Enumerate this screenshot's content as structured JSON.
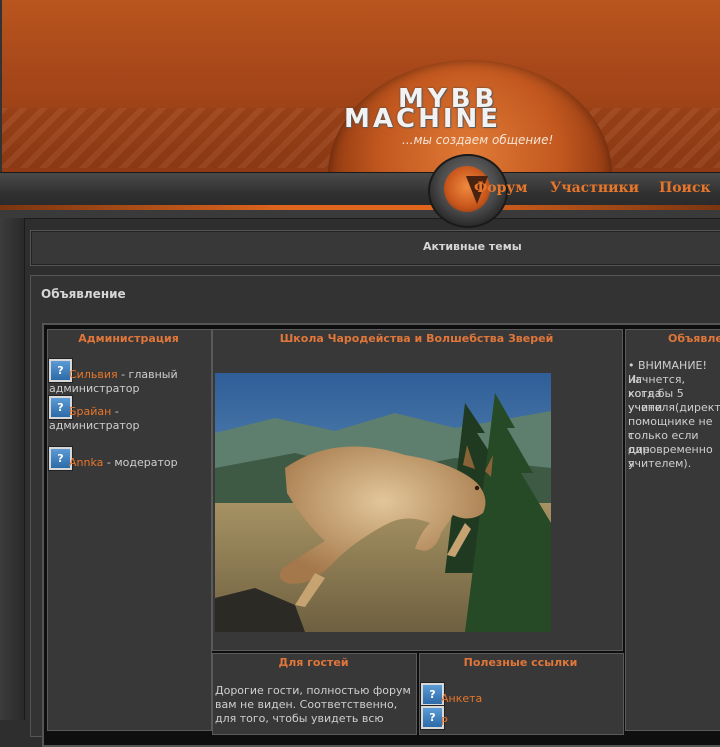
{
  "header": {
    "logo_line1": "MYBB",
    "logo_line2": "MACHINE",
    "slogan": "...мы создаем общение!"
  },
  "nav": {
    "items": [
      {
        "label": "Форум"
      },
      {
        "label": "Участники"
      },
      {
        "label": "Поиск"
      }
    ]
  },
  "active_topics": {
    "label": "Активные темы"
  },
  "announcement": {
    "title": "Объявление",
    "admin": {
      "heading": "Администрация",
      "members": [
        {
          "name": "Сильвия",
          "role": "- главный",
          "role2": "администратор"
        },
        {
          "name": "Брайан",
          "role": "-",
          "role2": "администратор"
        },
        {
          "name": "Annka",
          "role": "- модератор"
        }
      ]
    },
    "school": {
      "heading": "Школа Чародейства и Волшебства Зверей",
      "image_alt": "lynx"
    },
    "notice": {
      "heading": "Объявле",
      "lines": [
        "• ВНИМАНИЕ! Иг",
        "начнется, когда",
        "хотя бы 5 учени",
        "учителя(директ",
        "помощнике не с",
        "только если дир",
        "одновременно я",
        "учителем)."
      ]
    },
    "guests": {
      "heading": "Для гостей",
      "lines": [
        "Дорогие гости, полностью форум",
        "вам не виден. Соответственно,",
        "для того, чтобы увидеть всю"
      ]
    },
    "links": {
      "heading": "Полезные ссылки",
      "items": [
        {
          "label": "Анкета"
        },
        {
          "label": "Р"
        }
      ]
    }
  },
  "colors": {
    "accent": "#e8762a",
    "header_orange": "#b9551e",
    "background": "#2e2e2e"
  }
}
